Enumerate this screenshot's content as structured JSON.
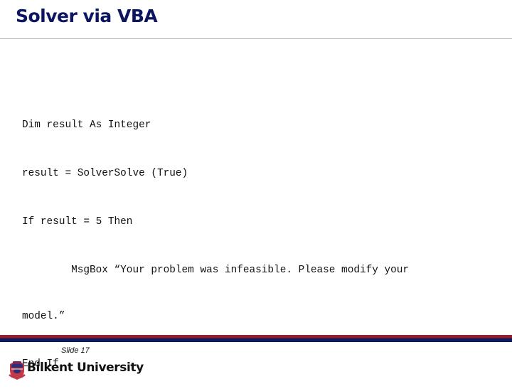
{
  "slide": {
    "title": "Solver via VBA",
    "code_lines": [
      "Dim result As Integer",
      "result = SolverSolve (True)",
      "If result = 5 Then",
      "        MsgBox “Your problem was infeasible. Please modify your",
      "model.”",
      "End If"
    ],
    "footer": {
      "slide_number_label": "Slide 17",
      "institution": "Bilkent University",
      "logo_icon": "university-crest-icon"
    }
  },
  "colors": {
    "title": "#0c1660",
    "stripe_red": "#9b1b2a",
    "stripe_blue": "#0e1a5e",
    "rule": "#b4b4b4"
  }
}
